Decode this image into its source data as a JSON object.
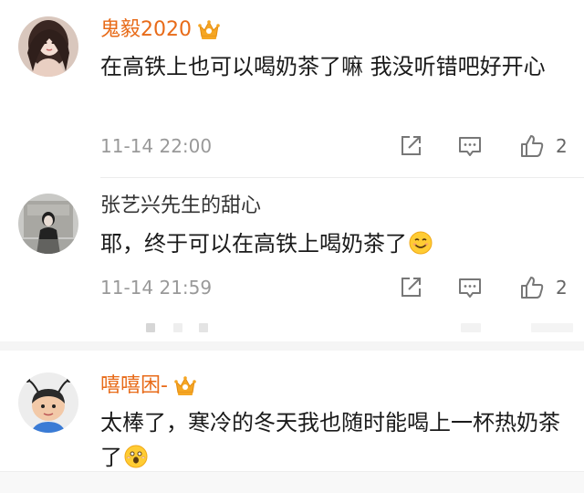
{
  "comments": [
    {
      "username": "鬼毅2020",
      "vip": true,
      "avatar": "portrait-woman-long-hair",
      "content": "在高铁上也可以喝奶茶了嘛 我没听错吧好开心",
      "emoji": null,
      "timestamp": "11-14 22:00",
      "likes": "2"
    },
    {
      "username": "张艺兴先生的甜心",
      "vip": false,
      "avatar": "portrait-person-dark-outfit",
      "content": "耶，终于可以在高铁上喝奶茶了",
      "emoji": "smile-emoji",
      "timestamp": "11-14 21:59",
      "likes": "2"
    },
    {
      "username": "嘻嘻困-",
      "vip": true,
      "avatar": "cartoon-child-antennae",
      "content": "太棒了，寒冷的冬天我也随时能喝上一杯热奶茶了",
      "emoji": "scared-emoji",
      "timestamp": null,
      "likes": null
    }
  ],
  "icons": {
    "share": "share-icon",
    "reply": "comment-icon",
    "like": "thumbs-up-icon",
    "vip": "crown-badge-icon"
  },
  "colors": {
    "vip_name": "#e86b19",
    "plain_name": "#333333",
    "text": "#1a1a1a",
    "meta": "#999999",
    "crown": "#f5a623"
  }
}
